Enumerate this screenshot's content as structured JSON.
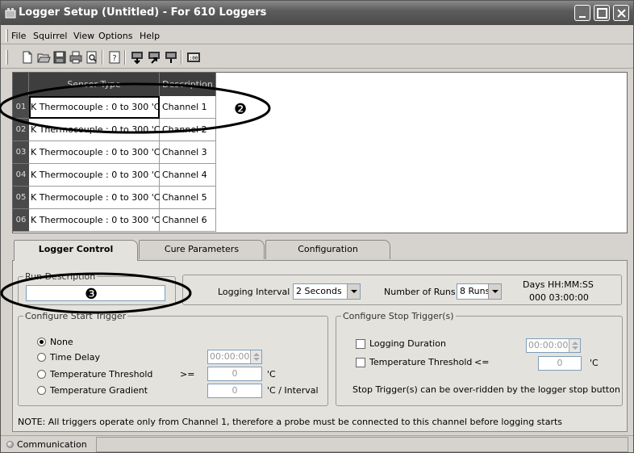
{
  "window": {
    "title": "Logger Setup (Untitled) - For 610 Loggers"
  },
  "menu": [
    "File",
    "Squirrel",
    "View",
    "Options",
    "Help"
  ],
  "toolbar": {
    "icons": [
      "new-icon",
      "open-icon",
      "save-icon",
      "print-icon",
      "print-preview-icon",
      "help-icon",
      "logger-download-icon",
      "logger-upload-icon",
      "logger-status-icon",
      "clock-icon"
    ]
  },
  "grid": {
    "headers": {
      "sensor_type": "Sensor Type",
      "description": "Description"
    },
    "rows": [
      {
        "num": "01",
        "type": "K Thermocouple : 0  to 300 'C",
        "desc": "Channel 1"
      },
      {
        "num": "02",
        "type": "K Thermocouple : 0  to 300 'C",
        "desc": "Channel 2"
      },
      {
        "num": "03",
        "type": "K Thermocouple : 0  to 300 'C",
        "desc": "Channel 3"
      },
      {
        "num": "04",
        "type": "K Thermocouple : 0  to 300 'C",
        "desc": "Channel 4"
      },
      {
        "num": "05",
        "type": "K Thermocouple : 0  to 300 'C",
        "desc": "Channel 5"
      },
      {
        "num": "06",
        "type": "K Thermocouple : 0  to 300 'C",
        "desc": "Channel 6"
      }
    ]
  },
  "tabs": [
    "Logger Control",
    "Cure Parameters",
    "Configuration"
  ],
  "logger_control": {
    "run_description": {
      "label": "Run Description",
      "value": ""
    },
    "logging_interval": {
      "label": "Logging Interval",
      "value": "2 Seconds"
    },
    "number_of_runs": {
      "label": "Number of Runs",
      "value": "8 Runs"
    },
    "duration": {
      "label": "Days HH:MM:SS",
      "value": "000  03:00:00"
    },
    "start_trigger": {
      "title": "Configure Start Trigger",
      "none": "None",
      "time_delay": "Time Delay",
      "time_delay_value": "00:00:00",
      "temp_threshold": "Temperature Threshold",
      "temp_threshold_op": ">=",
      "temp_threshold_value": "0",
      "temp_threshold_unit": "'C",
      "temp_gradient": "Temperature Gradient",
      "temp_gradient_value": "0",
      "temp_gradient_unit": "'C / Interval"
    },
    "stop_trigger": {
      "title": "Configure Stop Trigger(s)",
      "logging_duration": "Logging Duration",
      "logging_duration_value": "00:00:00",
      "temp_threshold": "Temperature Threshold",
      "temp_threshold_op": "<=",
      "temp_threshold_value": "0",
      "temp_threshold_unit": "'C",
      "note": "Stop Trigger(s) can be over-ridden by the logger stop button"
    },
    "note": "NOTE: All triggers operate only from Channel 1, therefore a probe must be connected to this channel before logging starts"
  },
  "status": {
    "label": "Communication",
    "value": ""
  },
  "callouts": [
    "❷",
    "❸"
  ]
}
